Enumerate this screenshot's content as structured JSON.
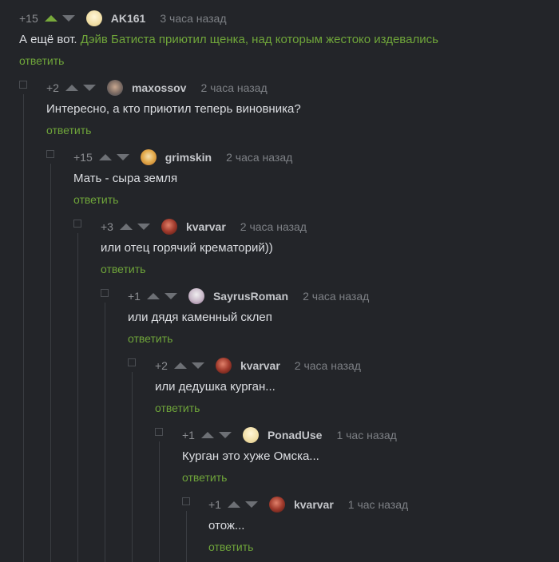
{
  "reply_label": "ответить",
  "colors": {
    "accent": "#78a93b",
    "background": "#232529"
  },
  "comments": [
    {
      "rating": "+15",
      "username": "AK161",
      "time": "3 часа назад",
      "text": "А ещё вот. ",
      "link": "Дэйв Батиста приютил щенка, над которым жестоко издевались",
      "avatar": "avatar-cream",
      "upvoted": true
    },
    {
      "rating": "+2",
      "username": "maxossov",
      "time": "2 часа назад",
      "text": "Интересно, а кто приютил теперь виновника?",
      "avatar": "avatar-photo"
    },
    {
      "rating": "+15",
      "username": "grimskin",
      "time": "2 часа назад",
      "text": "Мать - сыра земля",
      "avatar": "avatar-cartoon"
    },
    {
      "rating": "+3",
      "username": "kvarvar",
      "time": "2 часа назад",
      "text": "или отец горячий крематорий))",
      "avatar": "avatar-red"
    },
    {
      "rating": "+1",
      "username": "SayrusRoman",
      "time": "2 часа назад",
      "text": "или дядя каменный склеп",
      "avatar": "avatar-mask"
    },
    {
      "rating": "+2",
      "username": "kvarvar",
      "time": "2 часа назад",
      "text": "или дедушка курган...",
      "avatar": "avatar-red"
    },
    {
      "rating": "+1",
      "username": "PonadUse",
      "time": "1 час назад",
      "text": "Курган это хуже Омска...",
      "avatar": "avatar-cream"
    },
    {
      "rating": "+1",
      "username": "kvarvar",
      "time": "1 час назад",
      "text": "отож...",
      "avatar": "avatar-red"
    }
  ]
}
